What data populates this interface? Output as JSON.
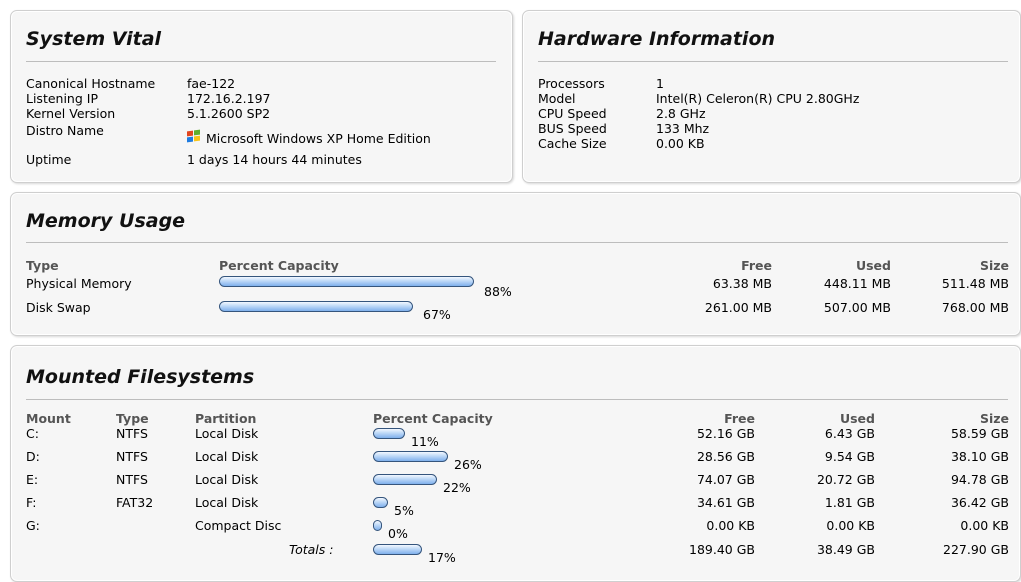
{
  "system_vital": {
    "title": "System Vital",
    "rows": [
      {
        "label": "Canonical Hostname",
        "value": "fae-122"
      },
      {
        "label": "Listening IP",
        "value": "172.16.2.197"
      },
      {
        "label": "Kernel Version",
        "value": "5.1.2600 SP2"
      },
      {
        "label": "Distro Name",
        "value": "Microsoft Windows XP Home Edition",
        "icon": "windows-logo-icon"
      },
      {
        "label": "Uptime",
        "value": "1 days 14 hours 44 minutes"
      }
    ]
  },
  "hardware": {
    "title": "Hardware Information",
    "rows": [
      {
        "label": "Processors",
        "value": "1"
      },
      {
        "label": "Model",
        "value": "Intel(R) Celeron(R) CPU 2.80GHz"
      },
      {
        "label": "CPU Speed",
        "value": "2.8 GHz"
      },
      {
        "label": "BUS Speed",
        "value": "133 Mhz"
      },
      {
        "label": "Cache Size",
        "value": "0.00 KB"
      }
    ]
  },
  "memory": {
    "title": "Memory Usage",
    "headers": {
      "type": "Type",
      "percent": "Percent Capacity",
      "free": "Free",
      "used": "Used",
      "size": "Size"
    },
    "rows": [
      {
        "type": "Physical Memory",
        "percent": 88,
        "percent_label": "88%",
        "free": "63.38 MB",
        "used": "448.11 MB",
        "size": "511.48 MB"
      },
      {
        "type": "Disk Swap",
        "percent": 67,
        "percent_label": "67%",
        "free": "261.00 MB",
        "used": "507.00 MB",
        "size": "768.00 MB"
      }
    ]
  },
  "filesystems": {
    "title": "Mounted Filesystems",
    "headers": {
      "mount": "Mount",
      "type": "Type",
      "partition": "Partition",
      "percent": "Percent Capacity",
      "free": "Free",
      "used": "Used",
      "size": "Size"
    },
    "rows": [
      {
        "mount": "C:",
        "type": "NTFS",
        "partition": "Local Disk",
        "percent": 11,
        "percent_label": "11%",
        "free": "52.16 GB",
        "used": "6.43 GB",
        "size": "58.59 GB"
      },
      {
        "mount": "D:",
        "type": "NTFS",
        "partition": "Local Disk",
        "percent": 26,
        "percent_label": "26%",
        "free": "28.56 GB",
        "used": "9.54 GB",
        "size": "38.10 GB"
      },
      {
        "mount": "E:",
        "type": "NTFS",
        "partition": "Local Disk",
        "percent": 22,
        "percent_label": "22%",
        "free": "74.07 GB",
        "used": "20.72 GB",
        "size": "94.78 GB"
      },
      {
        "mount": "F:",
        "type": "FAT32",
        "partition": "Local Disk",
        "percent": 5,
        "percent_label": "5%",
        "free": "34.61 GB",
        "used": "1.81 GB",
        "size": "36.42 GB"
      },
      {
        "mount": "G:",
        "type": "",
        "partition": "Compact Disc",
        "percent": 0,
        "percent_label": "0%",
        "free": "0.00 KB",
        "used": "0.00 KB",
        "size": "0.00 KB"
      }
    ],
    "totals": {
      "label": "Totals :",
      "percent": 17,
      "percent_label": "17%",
      "free": "189.40 GB",
      "used": "38.49 GB",
      "size": "227.90 GB"
    }
  },
  "colors": {
    "bar_border": "#35557d",
    "bar_fill": "#9cc4f2",
    "panel_bg": "#f6f6f6"
  }
}
